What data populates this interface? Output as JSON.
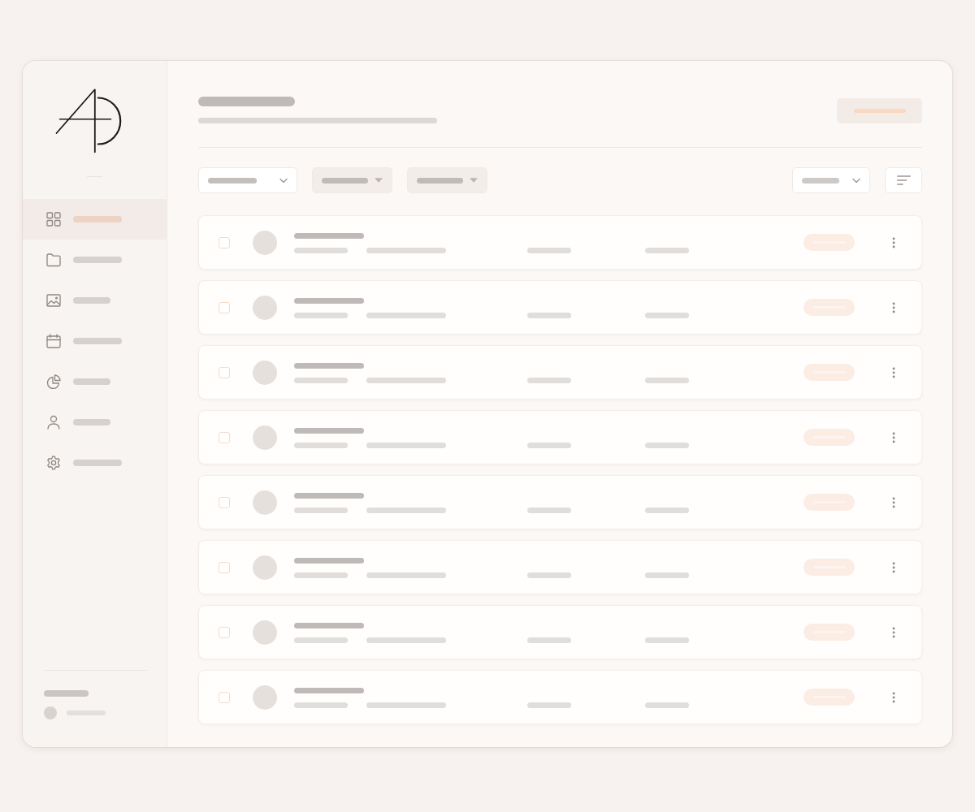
{
  "sidebar": {
    "items": [
      {
        "selected": true
      },
      {
        "selected": false
      },
      {
        "selected": false
      },
      {
        "selected": false
      },
      {
        "selected": false
      },
      {
        "selected": false
      },
      {
        "selected": false
      }
    ]
  },
  "toolbar": {
    "filters": [
      {
        "kind": "dropdown"
      },
      {
        "kind": "chip"
      },
      {
        "kind": "chip"
      }
    ]
  },
  "rows": [
    {
      "checked": false
    },
    {
      "checked": false
    },
    {
      "checked": false
    },
    {
      "checked": false
    },
    {
      "checked": false
    },
    {
      "checked": false
    },
    {
      "checked": false
    },
    {
      "checked": false
    }
  ]
}
